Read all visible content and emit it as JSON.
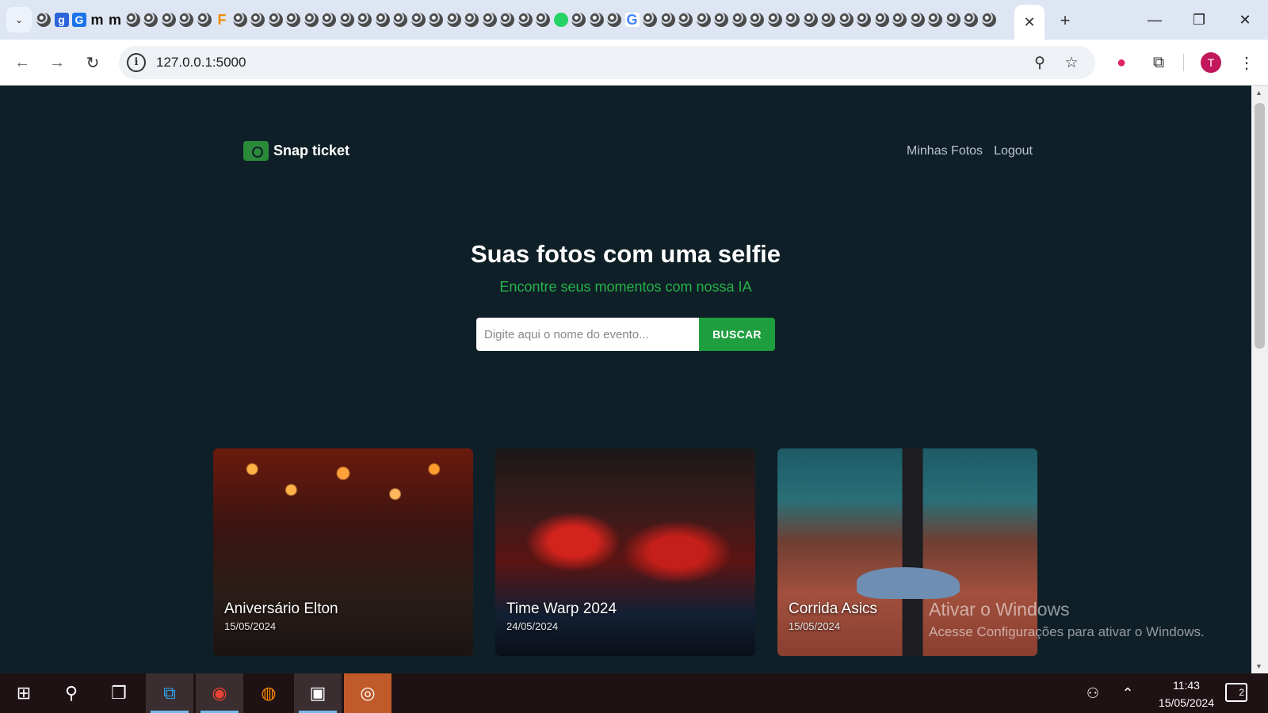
{
  "browser": {
    "active_tab_close": "✕",
    "new_tab": "+",
    "url": "127.0.0.1:5000",
    "window_controls": [
      "—",
      "❐",
      "✕"
    ],
    "profile_initial": "T"
  },
  "site": {
    "brand": "Snap ticket",
    "nav": [
      "Minhas Fotos",
      "Logout"
    ],
    "hero_title": "Suas fotos com uma selfie",
    "hero_subtitle": "Encontre seus momentos com nossa IA",
    "search_placeholder": "Digite aqui o nome do evento...",
    "search_button": "BUSCAR",
    "events": [
      {
        "title": "Aniversário Elton",
        "date": "15/05/2024"
      },
      {
        "title": "Time Warp 2024",
        "date": "24/05/2024"
      },
      {
        "title": "Corrida Asics",
        "date": "15/05/2024"
      }
    ]
  },
  "watermark": {
    "line1": "Ativar o Windows",
    "line2": "Acesse Configurações para ativar o Windows."
  },
  "taskbar": {
    "time": "11:43",
    "date": "15/05/2024",
    "notifications": "2"
  },
  "colors": {
    "page_bg": "#0f1f27",
    "accent_green": "#1e9e3e",
    "subtitle_green": "#27b44a"
  }
}
